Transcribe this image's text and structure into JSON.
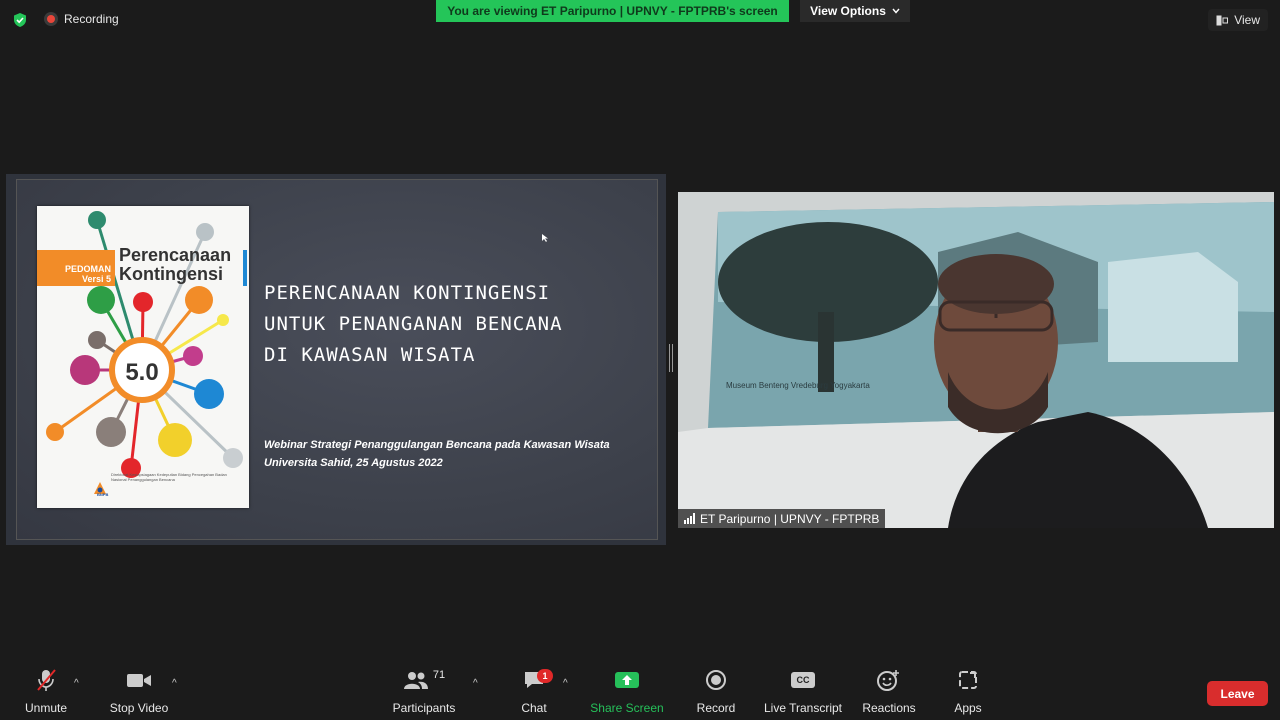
{
  "topbar": {
    "recording_label": "Recording",
    "banner_text": "You are viewing ET Paripurno | UPNVY - FPTPRB's screen",
    "view_options_label": "View Options",
    "view_label": "View",
    "banner_color": "#24c559"
  },
  "slide": {
    "cover_pedoman": "PEDOMAN",
    "cover_versi": "Versi 5",
    "cover_title_line1": "Perencanaan",
    "cover_title_line2": "Kontingensi",
    "cover_version_number": "5.0",
    "cover_org": "Direktorat Kesiapsiagaan Kedeputian Bidang Pencegahan Badan Nasional Penanggulangan Bencana",
    "cover_logo_text": "BNPB",
    "title_line1": "Perencanaan Kontingensi",
    "title_line2": "untuk Penanganan Bencana",
    "title_line3": "di Kawasan Wisata",
    "subtitle_line1": "Webinar Strategi Penanggulangan Bencana pada Kawasan Wisata",
    "subtitle_line2": "Universita Sahid, 25 Agustus 2022"
  },
  "video": {
    "participant_name": "ET Paripurno | UPNVY - FPTPRB",
    "poster_caption": "Museum Benteng Vredeburg Yogyakarta"
  },
  "toolbar": {
    "unmute_label": "Unmute",
    "stop_video_label": "Stop Video",
    "participants_label": "Participants",
    "participants_count": "71",
    "chat_label": "Chat",
    "chat_badge": "1",
    "share_screen_label": "Share Screen",
    "record_label": "Record",
    "live_transcript_label": "Live Transcript",
    "cc_icon_text": "CC",
    "reactions_label": "Reactions",
    "apps_label": "Apps",
    "leave_label": "Leave",
    "share_color": "#26c05a",
    "leave_color": "#d92d2d"
  }
}
